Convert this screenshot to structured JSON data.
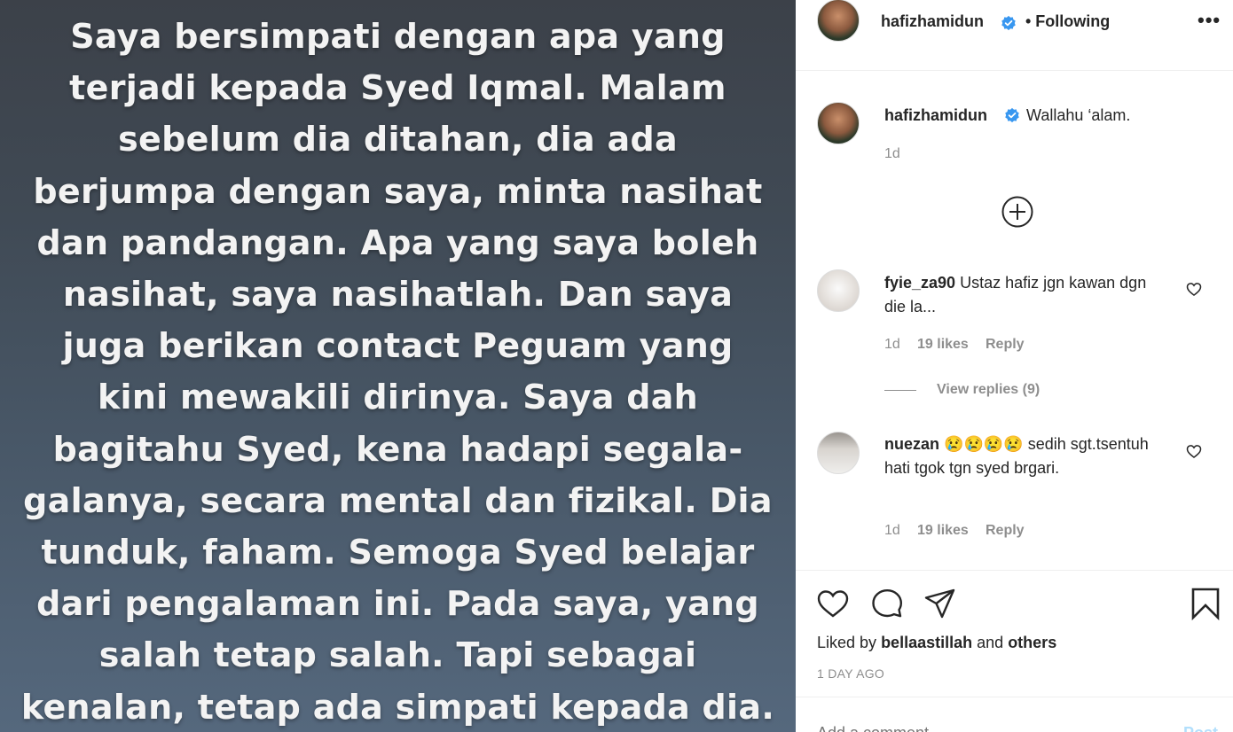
{
  "image": {
    "lines": [
      "Saya bersimpati dengan apa yang",
      "terjadi kepada Syed Iqmal. Malam",
      "sebelum dia ditahan, dia ada",
      "berjumpa dengan saya, minta nasihat",
      "dan pandangan. Apa yang saya boleh",
      "nasihat, saya nasihatlah. Dan saya",
      "juga berikan contact Peguam yang",
      "kini mewakili dirinya. Saya dah",
      "bagitahu Syed, kena hadapi segala-",
      "galanya, secara mental dan fizikal. Dia",
      "tunduk, faham. Semoga Syed belajar",
      "dari pengalaman ini. Pada saya, yang",
      "salah tetap salah. Tapi sebagai",
      "kenalan, tetap ada simpati kepada dia."
    ]
  },
  "header": {
    "username": "hafizhamidun",
    "following_label": "• Following",
    "more_icon": "more-icon"
  },
  "caption": {
    "username": "hafizhamidun",
    "text": "Wallahu ‘alam.",
    "time": "1d"
  },
  "load_more_icon": "plus-circle-icon",
  "comments": [
    {
      "username": "fyie_za90",
      "text": "Ustaz hafiz jgn kawan dgn die la...",
      "time": "1d",
      "likes": "19 likes",
      "reply": "Reply",
      "view_replies": "View replies (9)"
    },
    {
      "username": "nuezan",
      "emoji": "😢😢😢😢",
      "text": "sedih sgt.tsentuh hati tgok tgn syed brgari.",
      "time": "1d",
      "likes": "19 likes",
      "reply": "Reply"
    }
  ],
  "actions": {
    "liked_by_prefix": "Liked by",
    "liked_by_user": "bellaastillah",
    "liked_by_and": "and",
    "liked_by_others": "others",
    "timestamp": "1 DAY AGO"
  },
  "add_comment": {
    "placeholder": "Add a comment...",
    "post_label": "Post"
  },
  "colors": {
    "verified": "#3897f0",
    "muted": "#8e8e8e",
    "text": "#262626",
    "post_disabled": "#b2dffc"
  }
}
